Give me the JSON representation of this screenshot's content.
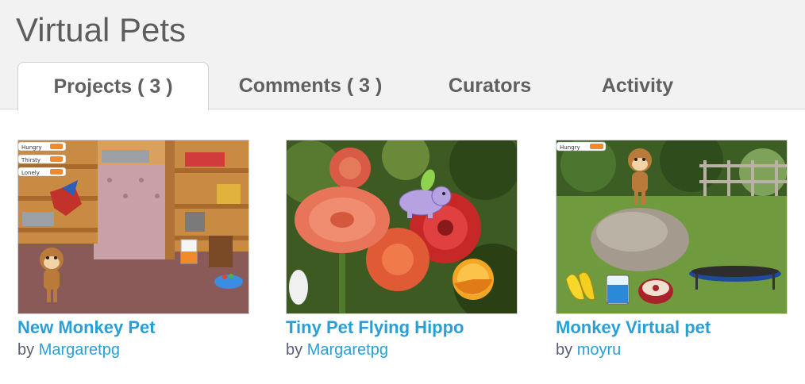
{
  "studio": {
    "title": "Virtual Pets"
  },
  "tabs": [
    {
      "label": "Projects ( 3 )",
      "active": true
    },
    {
      "label": "Comments ( 3 )",
      "active": false
    },
    {
      "label": "Curators",
      "active": false
    },
    {
      "label": "Activity",
      "active": false
    }
  ],
  "projects": [
    {
      "title": "New Monkey Pet",
      "by": "by",
      "author": "Margaretpg",
      "thumbnail": "monkey-room-thumbnail",
      "thumbnail_labels": [
        "Hungry",
        "Thirsty",
        "Lonely"
      ]
    },
    {
      "title": "Tiny Pet Flying Hippo",
      "by": "by",
      "author": "Margaretpg",
      "thumbnail": "flowers-hippo-thumbnail"
    },
    {
      "title": "Monkey Virtual pet",
      "by": "by",
      "author": "moyru",
      "thumbnail": "monkey-rock-thumbnail",
      "thumbnail_labels": [
        "Hungry"
      ]
    }
  ],
  "colors": {
    "link": "#2a9fd6",
    "header_bg": "#f2f2f2",
    "tab_text": "#606060"
  }
}
